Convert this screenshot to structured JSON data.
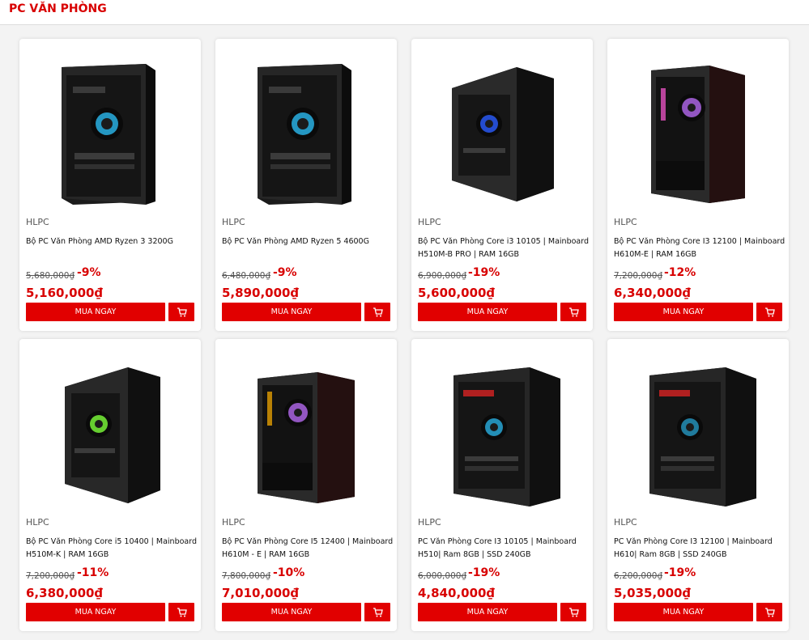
{
  "section": {
    "title": "PC VĂN PHÒNG"
  },
  "colors": {
    "accent": "#e10000",
    "price": "#d80000"
  },
  "products": [
    {
      "brand": "HLPC",
      "name": "Bộ PC Văn Phòng AMD Ryzen 3 3200G",
      "old_price": "5,680,000₫",
      "discount": "-9%",
      "price": "5,160,000₫",
      "buy_label": "MUA NGAY",
      "cart_icon": "cart-icon",
      "image_icon": "pc-case-icon"
    },
    {
      "brand": "HLPC",
      "name": "Bộ PC Văn Phòng AMD Ryzen 5 4600G",
      "old_price": "6,480,000₫",
      "discount": "-9%",
      "price": "5,890,000₫",
      "buy_label": "MUA NGAY",
      "cart_icon": "cart-icon",
      "image_icon": "pc-case-icon"
    },
    {
      "brand": "HLPC",
      "name": "Bộ PC Văn Phòng Core i3 10105 | Mainboard H510M-B PRO | RAM 16GB",
      "old_price": "6,900,000₫",
      "discount": "-19%",
      "price": "5,600,000₫",
      "buy_label": "MUA NGAY",
      "cart_icon": "cart-icon",
      "image_icon": "pc-case-icon"
    },
    {
      "brand": "HLPC",
      "name": "Bộ PC Văn Phòng Core I3 12100 | Mainboard H610M-E | RAM 16GB",
      "old_price": "7,200,000₫",
      "discount": "-12%",
      "price": "6,340,000₫",
      "buy_label": "MUA NGAY",
      "cart_icon": "cart-icon",
      "image_icon": "pc-case-icon"
    },
    {
      "brand": "HLPC",
      "name": "Bộ PC Văn Phòng Core i5 10400 | Mainboard H510M-K | RAM 16GB",
      "old_price": "7,200,000₫",
      "discount": "-11%",
      "price": "6,380,000₫",
      "buy_label": "MUA NGAY",
      "cart_icon": "cart-icon",
      "image_icon": "pc-case-icon"
    },
    {
      "brand": "HLPC",
      "name": "Bộ PC Văn Phòng Core I5 12400 | Mainboard H610M - E | RAM 16GB",
      "old_price": "7,800,000₫",
      "discount": "-10%",
      "price": "7,010,000₫",
      "buy_label": "MUA NGAY",
      "cart_icon": "cart-icon",
      "image_icon": "pc-case-icon"
    },
    {
      "brand": "HLPC",
      "name": "PC Văn Phòng Core I3 10105 | Mainboard H510| Ram 8GB | SSD 240GB",
      "old_price": "6,000,000₫",
      "discount": "-19%",
      "price": "4,840,000₫",
      "buy_label": "MUA NGAY",
      "cart_icon": "cart-icon",
      "image_icon": "pc-case-icon"
    },
    {
      "brand": "HLPC",
      "name": "PC Văn Phòng Core I3 12100 | Mainboard H610| Ram 8GB | SSD 240GB",
      "old_price": "6,200,000₫",
      "discount": "-19%",
      "price": "5,035,000₫",
      "buy_label": "MUA NGAY",
      "cart_icon": "cart-icon",
      "image_icon": "pc-case-icon"
    }
  ]
}
